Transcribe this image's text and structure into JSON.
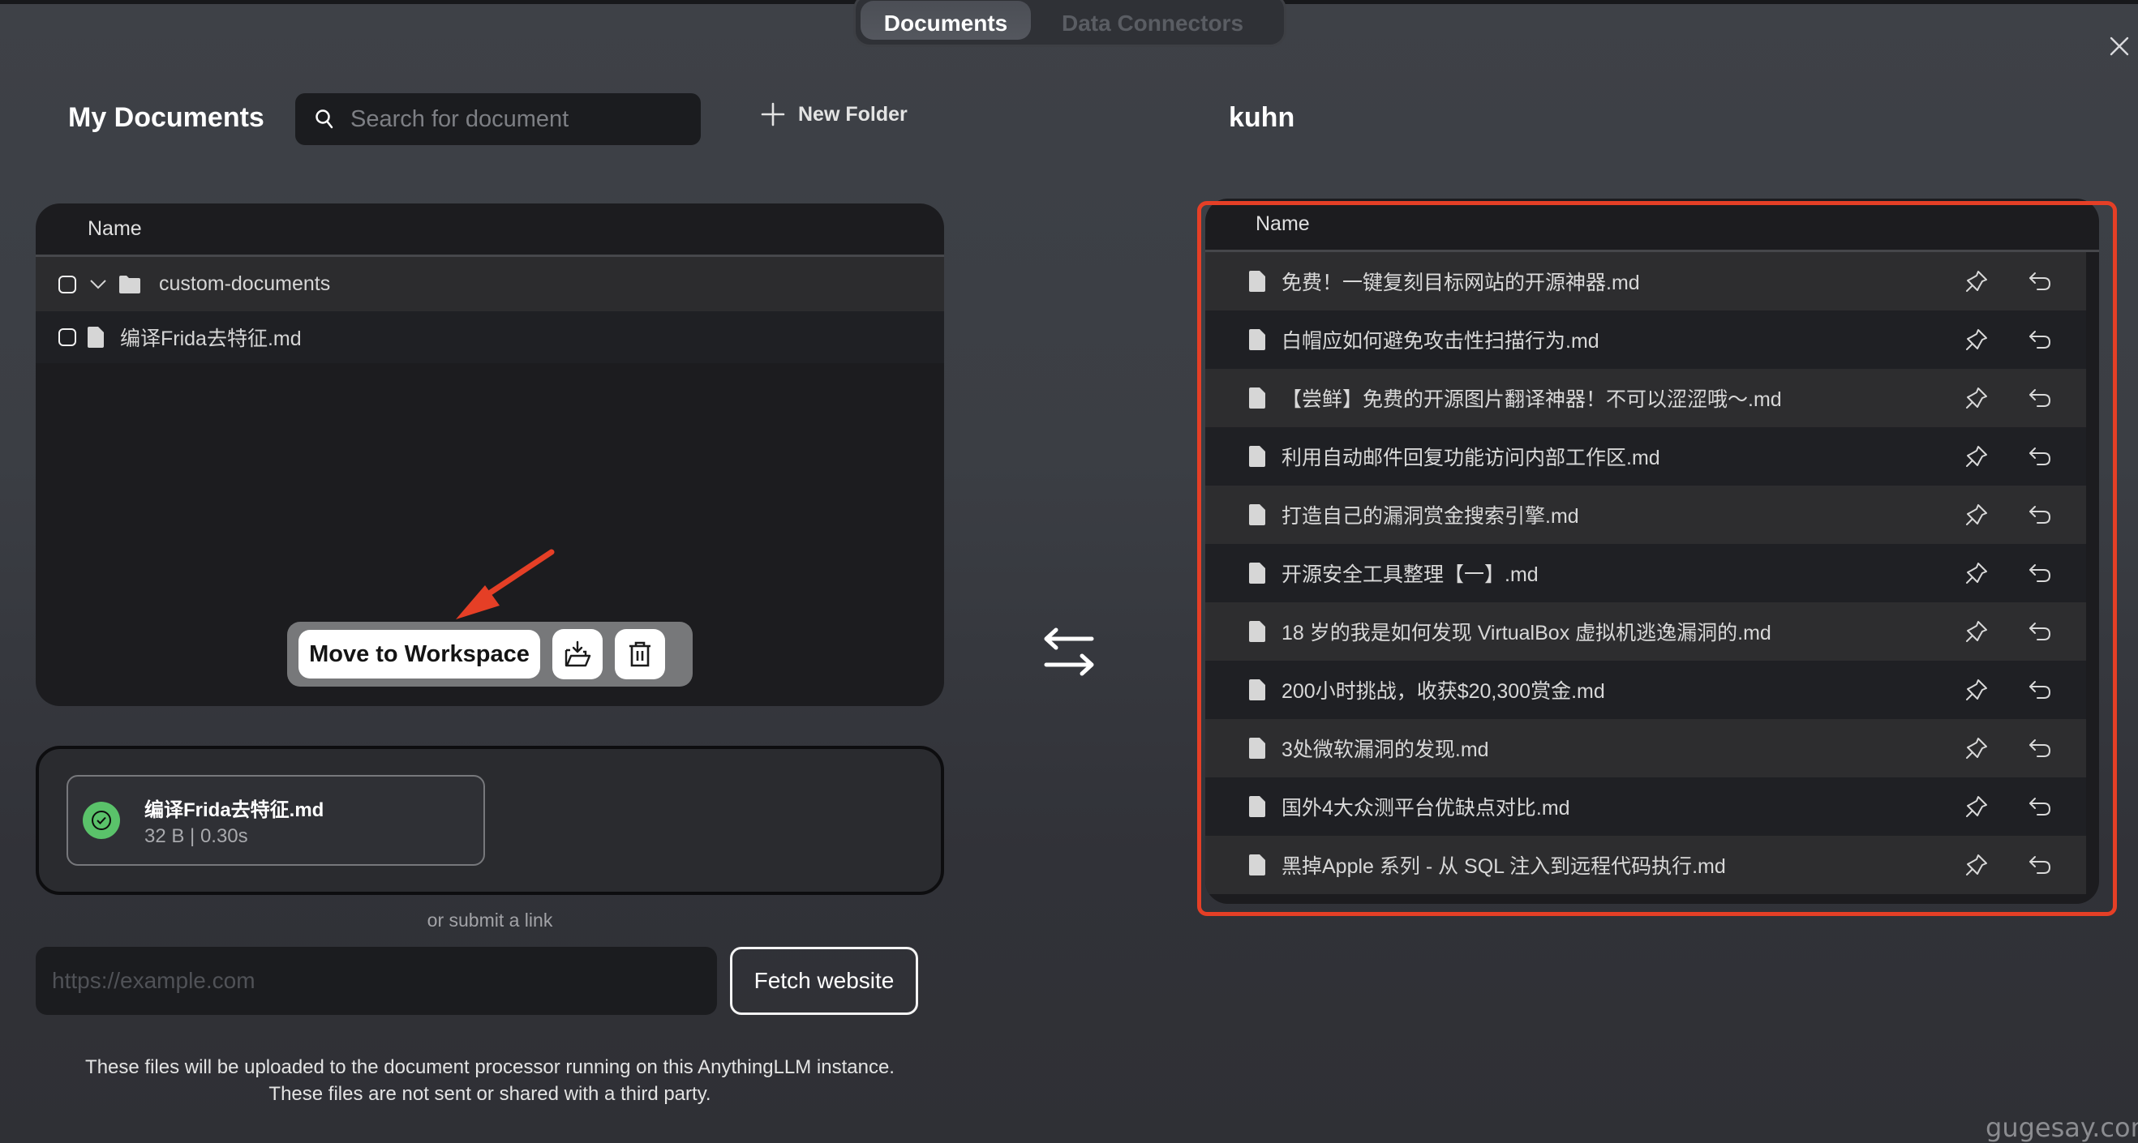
{
  "tabs": [
    {
      "label": "Documents",
      "active": true
    },
    {
      "label": "Data Connectors",
      "active": false
    }
  ],
  "left": {
    "title": "My Documents",
    "search_placeholder": "Search for document",
    "new_folder_label": "New Folder",
    "table_header": "Name",
    "tree": {
      "folder_name": "custom-documents",
      "files": [
        "编译Frida去特征.md"
      ]
    },
    "actions": {
      "move_label": "Move to Workspace",
      "download_icon": "folder-download-icon",
      "delete_icon": "trash-icon"
    }
  },
  "upload": {
    "file_name": "编译Frida去特征.md",
    "file_info": "32 B | 0.30s",
    "status": "success",
    "status_color": "#5ac26a"
  },
  "link": {
    "or_label": "or submit a link",
    "url_placeholder": "https://example.com",
    "fetch_label": "Fetch website"
  },
  "disclaimer": {
    "line1": "These files will be uploaded to the document processor running on this AnythingLLM instance.",
    "line2": "These files are not sent or shared with a third party."
  },
  "right": {
    "workspace_name": "kuhn",
    "table_header": "Name",
    "documents": [
      "免费！一键复刻目标网站的开源神器.md",
      "白帽应如何避免攻击性扫描行为.md",
      "【尝鲜】免费的开源图片翻译神器！不可以涩涩哦～.md",
      "利用自动邮件回复功能访问内部工作区.md",
      "打造自己的漏洞赏金搜索引擎.md",
      "开源安全工具整理【一】.md",
      "18 岁的我是如何发现 VirtualBox 虚拟机逃逸漏洞的.md",
      "200小时挑战，收获$20,300赏金.md",
      "3处微软漏洞的发现.md",
      "国外4大众测平台优缺点对比.md",
      "黑掉Apple 系列 - 从 SQL 注入到远程代码执行.md"
    ]
  },
  "annotation_color": "#e53f26",
  "watermark": "gugesay.com"
}
